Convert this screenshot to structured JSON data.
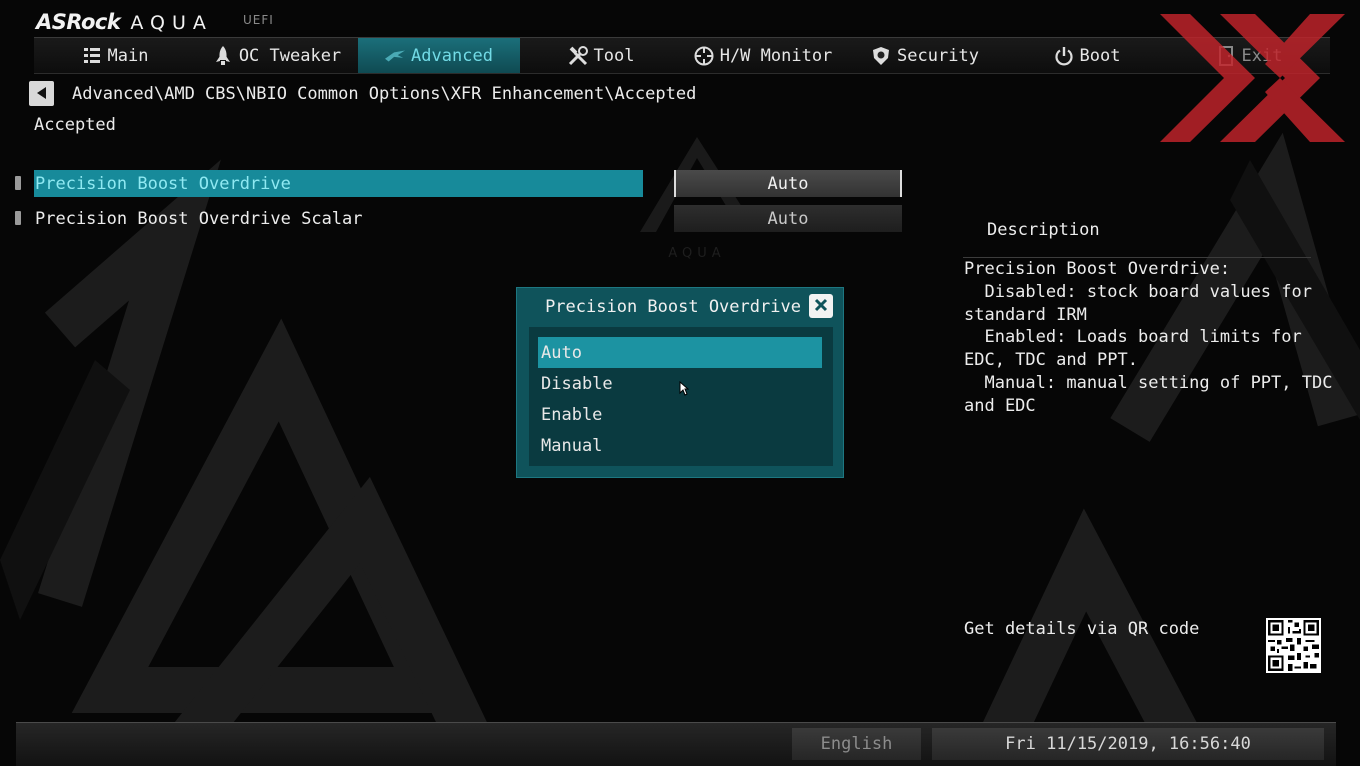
{
  "brand": {
    "name": "ASRock",
    "product": "AQUA",
    "suffix": "UEFI"
  },
  "nav": {
    "tabs": [
      {
        "label": "Main",
        "icon": "list-icon",
        "active": false
      },
      {
        "label": "OC Tweaker",
        "icon": "rocket-icon",
        "active": false
      },
      {
        "label": "Advanced",
        "icon": "star-icon",
        "active": true
      },
      {
        "label": "Tool",
        "icon": "tools-icon",
        "active": false
      },
      {
        "label": "H/W Monitor",
        "icon": "crosshair-icon",
        "active": false
      },
      {
        "label": "Security",
        "icon": "shield-icon",
        "active": false
      },
      {
        "label": "Boot",
        "icon": "power-icon",
        "active": false
      },
      {
        "label": "Exit",
        "icon": "door-icon",
        "active": false
      }
    ]
  },
  "breadcrumb": "Advanced\\AMD CBS\\NBIO Common Options\\XFR Enhancement\\Accepted",
  "page_title": "Accepted",
  "settings": [
    {
      "label": "Precision Boost Overdrive",
      "value": "Auto",
      "selected": true
    },
    {
      "label": "Precision Boost Overdrive Scalar",
      "value": "Auto",
      "selected": false
    }
  ],
  "description": {
    "title": "Description",
    "text": "Precision Boost Overdrive:\n  Disabled: stock board values for\nstandard IRM\n  Enabled: Loads board limits for\nEDC, TDC and PPT.\n  Manual: manual setting of PPT, TDC\nand EDC",
    "qr_text": "Get details via QR code"
  },
  "popup": {
    "title": "Precision Boost Overdrive",
    "options": [
      "Auto",
      "Disable",
      "Enable",
      "Manual"
    ],
    "selected_option": "Auto"
  },
  "footer": {
    "language": "English",
    "datetime": "Fri 11/15/2019, 16:56:40"
  },
  "colors": {
    "accent": "#178a9a",
    "accent_text": "#72dbe6",
    "popup_bg": "#0f535b",
    "watermark_red": "#c4242b"
  }
}
